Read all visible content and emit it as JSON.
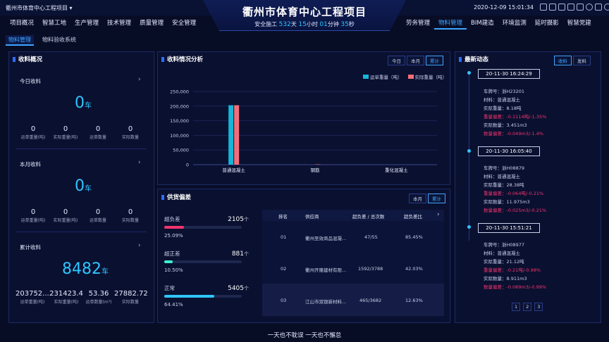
{
  "header": {
    "project_name": "衢州市体育中心工程项目",
    "project_caret": "▾",
    "title": "衢州市体育中心工程项目",
    "safety_prefix": "安全施工",
    "safety_value1": "532",
    "safety_unit1": "天",
    "safety_value2": "15",
    "safety_unit2": "小时",
    "safety_value3": "01",
    "safety_unit3": "分钟",
    "safety_value4": "35",
    "safety_unit4": "秒",
    "datetime": "2020-12-09 15:01:34"
  },
  "nav_left": [
    "项目概况",
    "智慧工地",
    "生产管理",
    "技术管理",
    "质量管理",
    "安全管理"
  ],
  "nav_right": [
    "劳务管理",
    "物料管理",
    "BIM建造",
    "环境监测",
    "延时摄影",
    "智慧党建"
  ],
  "nav_active": "物料管理",
  "subnav": [
    "物料管理",
    "物料验收系统"
  ],
  "receipt_overview": {
    "title": "收料概况",
    "today": {
      "label": "今日收料",
      "big": "0",
      "unit": "车",
      "stats": [
        {
          "v": "0",
          "l": "运单重量(吨)"
        },
        {
          "v": "0",
          "l": "实际重量(吨)"
        },
        {
          "v": "0",
          "l": "运单数量"
        },
        {
          "v": "0",
          "l": "实际数量"
        }
      ]
    },
    "month": {
      "label": "本月收料",
      "big": "0",
      "unit": "车",
      "stats": [
        {
          "v": "0",
          "l": "运单重量(吨)"
        },
        {
          "v": "0",
          "l": "实际重量(吨)"
        },
        {
          "v": "0",
          "l": "运单数量"
        },
        {
          "v": "0",
          "l": "实际数量"
        }
      ]
    },
    "total": {
      "label": "累计收料",
      "big": "8482",
      "unit": "车",
      "stats": [
        {
          "v": "203752....",
          "l": "运单重量(吨)"
        },
        {
          "v": "231423.4",
          "l": "实际重量(吨)"
        },
        {
          "v": "53.36",
          "l": "运单数量(m³)"
        },
        {
          "v": "27882.72",
          "l": "实际数量"
        }
      ]
    }
  },
  "receipt_analysis": {
    "title": "收料情况分析",
    "buttons": [
      "今日",
      "本月",
      "累计"
    ],
    "active": "累计",
    "legend": [
      "运单重量（吨）",
      "实际重量（吨）"
    ]
  },
  "chart_data": {
    "type": "bar",
    "categories": [
      "普通混凝土",
      "钢筋",
      "重化混凝土"
    ],
    "series": [
      {
        "name": "运单重量（吨）",
        "values": [
          203000,
          0,
          0
        ],
        "color": "#17b6d8"
      },
      {
        "name": "实际重量（吨）",
        "values": [
          203000,
          1200,
          0
        ],
        "color": "#f06e7a"
      }
    ],
    "yticks": [
      "0",
      "50,000",
      "100,000",
      "150,000",
      "200,000",
      "250,000"
    ],
    "ylim": [
      0,
      250000
    ],
    "grid": true,
    "legend_position": "top-right"
  },
  "supply": {
    "title": "供货偏差",
    "buttons": [
      "本月",
      "累计"
    ],
    "active": "累计",
    "items": [
      {
        "label": "超负差",
        "count": "2105",
        "unit": "个",
        "pct": "25.09%",
        "fill": 0.2509,
        "color": "#f0356e"
      },
      {
        "label": "超正差",
        "count": "881",
        "unit": "个",
        "pct": "10.50%",
        "fill": 0.105,
        "color": "#3df0d0"
      },
      {
        "label": "正常",
        "count": "5405",
        "unit": "个",
        "pct": "64.41%",
        "fill": 0.6441,
        "color": "#2ec5ff"
      }
    ],
    "table": {
      "headers": [
        "排名",
        "供应商",
        "超负差 / 总次数",
        "超负差比"
      ],
      "next": "›",
      "rows": [
        [
          "01",
          "衢州至效商品混凝...",
          "47/55",
          "85.45%"
        ],
        [
          "02",
          "衢州开隆建材有限...",
          "1592/3788",
          "42.03%"
        ],
        [
          "03",
          "江山市双银新材料...",
          "465/3682",
          "12.63%"
        ]
      ]
    }
  },
  "latest": {
    "title": "最新动态",
    "buttons": [
      "收料",
      "发料"
    ],
    "active": "收料",
    "entries": [
      {
        "time": "20-11-30 16:24:29",
        "plate": "车牌号：浙H23201",
        "material": "材料：普通混凝土",
        "weight": "实际重量：8.18吨",
        "wdev": "重量偏差：-0.1114吨/-1.35%",
        "qty": "实际数量：3.451m3",
        "qdev": "数量偏差：-0.049m3/-1.4%"
      },
      {
        "time": "20-11-30 16:05:40",
        "plate": "车牌号：浙H08879",
        "material": "材料：普通混凝土",
        "weight": "实际重量：28.38吨",
        "wdev": "重量偏差：-0.064吨/-0.21%",
        "qty": "实际数量：11.975m3",
        "qdev": "数量偏差：-0.025m3/-0.21%"
      },
      {
        "time": "20-11-30 15:51:21",
        "plate": "车牌号：浙H08977",
        "material": "材料：普通混凝土",
        "weight": "实际重量：21.12吨",
        "wdev": "重量偏差：-0.21吨/-0.98%",
        "qty": "实际数量：8.911m3",
        "qdev": "数量偏差：-0.089m3/-0.99%"
      }
    ],
    "pages": [
      "1",
      "2",
      "3"
    ]
  },
  "footer": "一天也不耽误 一天也不懈怠",
  "colors": {
    "accent": "#2ec5ff",
    "negative": "#f0356e",
    "panel_border": "#1c2a66"
  }
}
